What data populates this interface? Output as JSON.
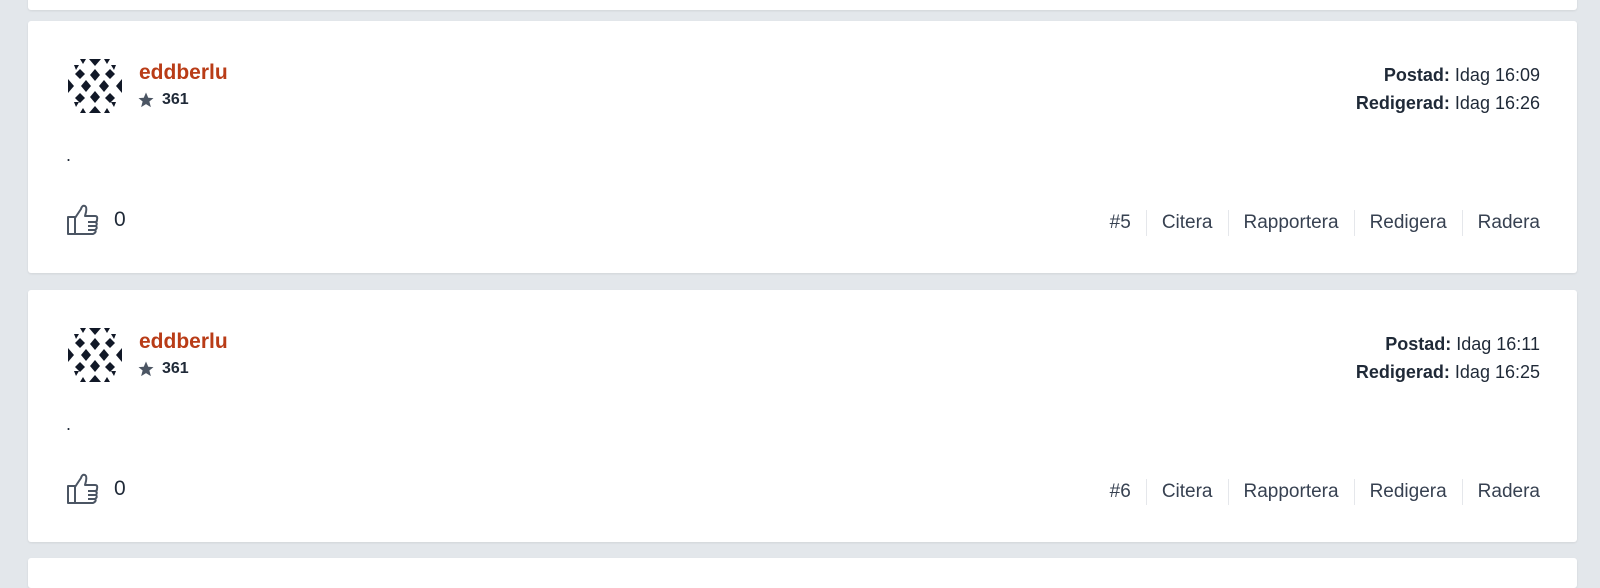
{
  "posts": [
    {
      "author": "eddberlu",
      "reputation": "361",
      "posted_label": "Postad:",
      "posted_value": "Idag 16:09",
      "edited_label": "Redigerad:",
      "edited_value": "Idag 16:26",
      "body": ".",
      "likes": "0",
      "number": "#5",
      "actions": [
        "Citera",
        "Rapportera",
        "Redigera",
        "Radera"
      ]
    },
    {
      "author": "eddberlu",
      "reputation": "361",
      "posted_label": "Postad:",
      "posted_value": "Idag 16:11",
      "edited_label": "Redigerad:",
      "edited_value": "Idag 16:25",
      "body": ".",
      "likes": "0",
      "number": "#6",
      "actions": [
        "Citera",
        "Rapportera",
        "Redigera",
        "Radera"
      ]
    }
  ],
  "colors": {
    "background": "#e3e7eb",
    "card": "#ffffff",
    "author": "#b93c17",
    "text": "#1f2937",
    "icon": "#4b5563"
  },
  "icons": {
    "avatar": "geometric-identicon",
    "reputation": "star-icon",
    "like": "thumbs-up-icon"
  }
}
